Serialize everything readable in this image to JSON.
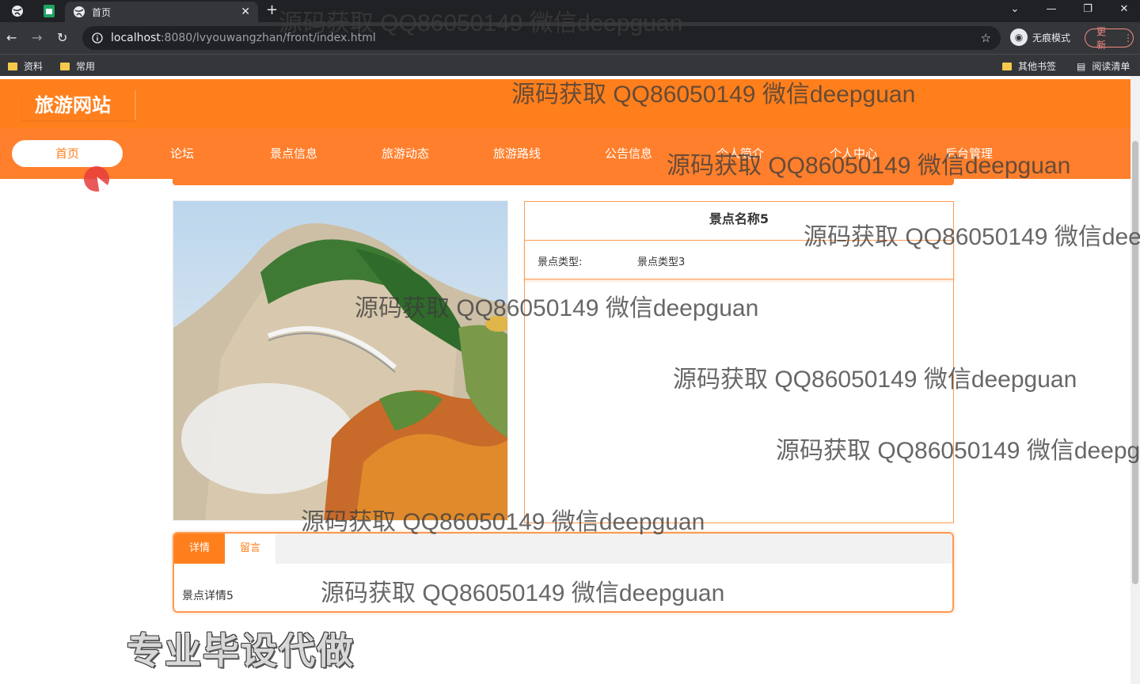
{
  "browser": {
    "tab_title": "首页",
    "url_host": "localhost",
    "url_rest": ":8080/lvyouwangzhan/front/index.html",
    "incognito_label": "无痕模式",
    "update_label": "更新",
    "bookmarks": [
      "资料",
      "常用"
    ],
    "bookmarks_right": [
      "其他书签",
      "阅读清单"
    ]
  },
  "site": {
    "logo": "旅游网站",
    "nav": [
      "首页",
      "论坛",
      "景点信息",
      "旅游动态",
      "旅游路线",
      "公告信息",
      "个人简介",
      "个人中心",
      "后台管理"
    ],
    "nav_active": "首页"
  },
  "detail": {
    "name": "景点名称5",
    "type_label": "景点类型:",
    "type_value": "景点类型3",
    "tabs": [
      "详情",
      "留言"
    ],
    "content": "景点详情5"
  },
  "promo_text": "专业毕设代做",
  "watermark": "源码获取 QQ86050149 微信deepguan",
  "colors": {
    "accent": "#ff7f1c",
    "nav": "#ff7f2c",
    "border": "#ff9a52"
  }
}
